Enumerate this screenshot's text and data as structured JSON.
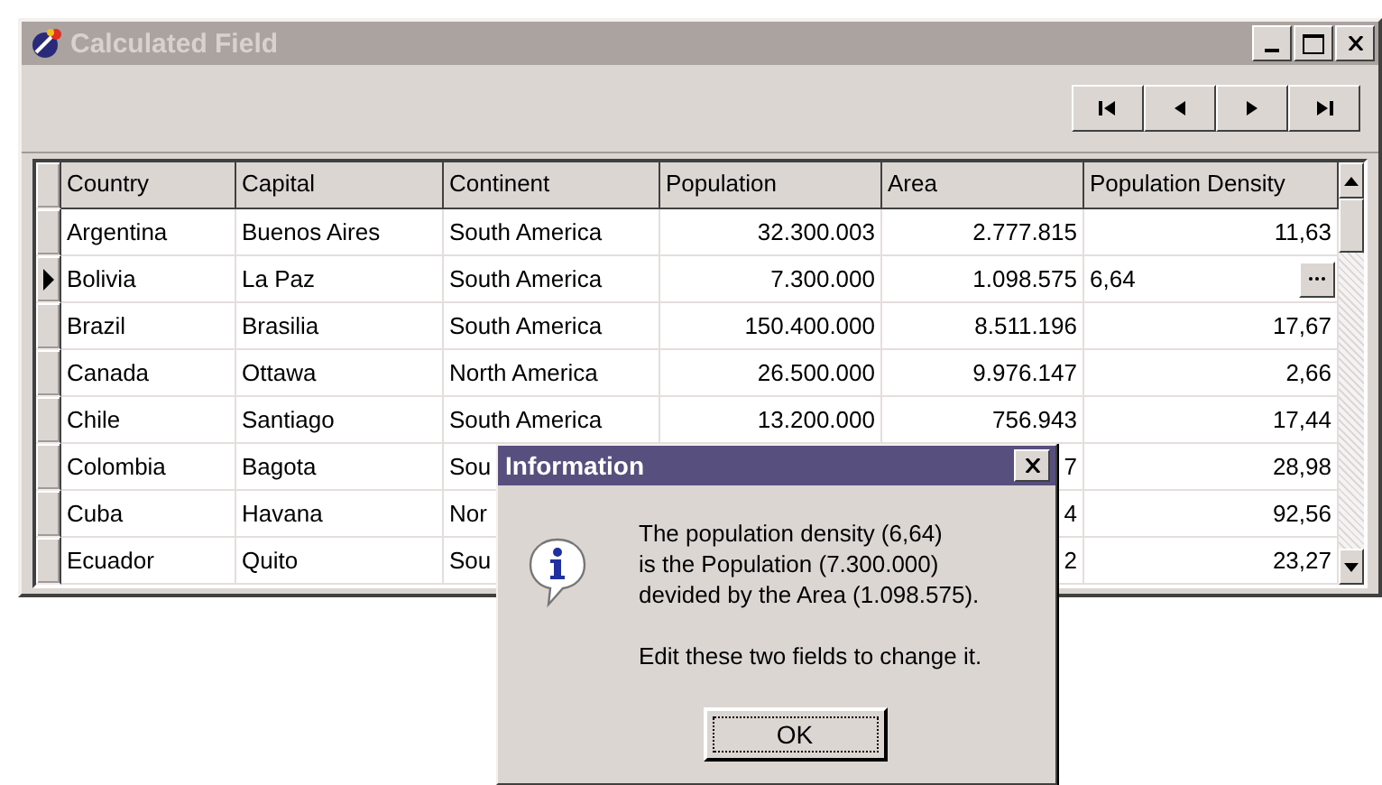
{
  "window": {
    "title": "Calculated Field"
  },
  "grid": {
    "columns": [
      "Country",
      "Capital",
      "Continent",
      "Population",
      "Area",
      "Population Density"
    ],
    "rows": [
      {
        "selected": false,
        "editing": false,
        "cells": [
          "Argentina",
          "Buenos Aires",
          "South America",
          "32.300.003",
          "2.777.815",
          "11,63"
        ]
      },
      {
        "selected": true,
        "editing": true,
        "cells": [
          "Bolivia",
          "La Paz",
          "South America",
          "7.300.000",
          "1.098.575",
          "6,64"
        ]
      },
      {
        "selected": false,
        "editing": false,
        "cells": [
          "Brazil",
          "Brasilia",
          "South America",
          "150.400.000",
          "8.511.196",
          "17,67"
        ]
      },
      {
        "selected": false,
        "editing": false,
        "cells": [
          "Canada",
          "Ottawa",
          "North America",
          "26.500.000",
          "9.976.147",
          "2,66"
        ]
      },
      {
        "selected": false,
        "editing": false,
        "cells": [
          "Chile",
          "Santiago",
          "South America",
          "13.200.000",
          "756.943",
          "17,44"
        ]
      },
      {
        "selected": false,
        "editing": false,
        "cells": [
          "Colombia",
          "Bagota",
          "Sou",
          null,
          "7",
          "28,98"
        ]
      },
      {
        "selected": false,
        "editing": false,
        "cells": [
          "Cuba",
          "Havana",
          "Nor",
          null,
          "4",
          "92,56"
        ]
      },
      {
        "selected": false,
        "editing": false,
        "cells": [
          "Ecuador",
          "Quito",
          "Sou",
          null,
          "2",
          "23,27"
        ]
      }
    ]
  },
  "dialog": {
    "title": "Information",
    "message": [
      "The population density (6,64)",
      "is the Population (7.300.000)",
      "devided by the Area (1.098.575)."
    ],
    "hint": "Edit these two fields to change it.",
    "button": "OK"
  }
}
